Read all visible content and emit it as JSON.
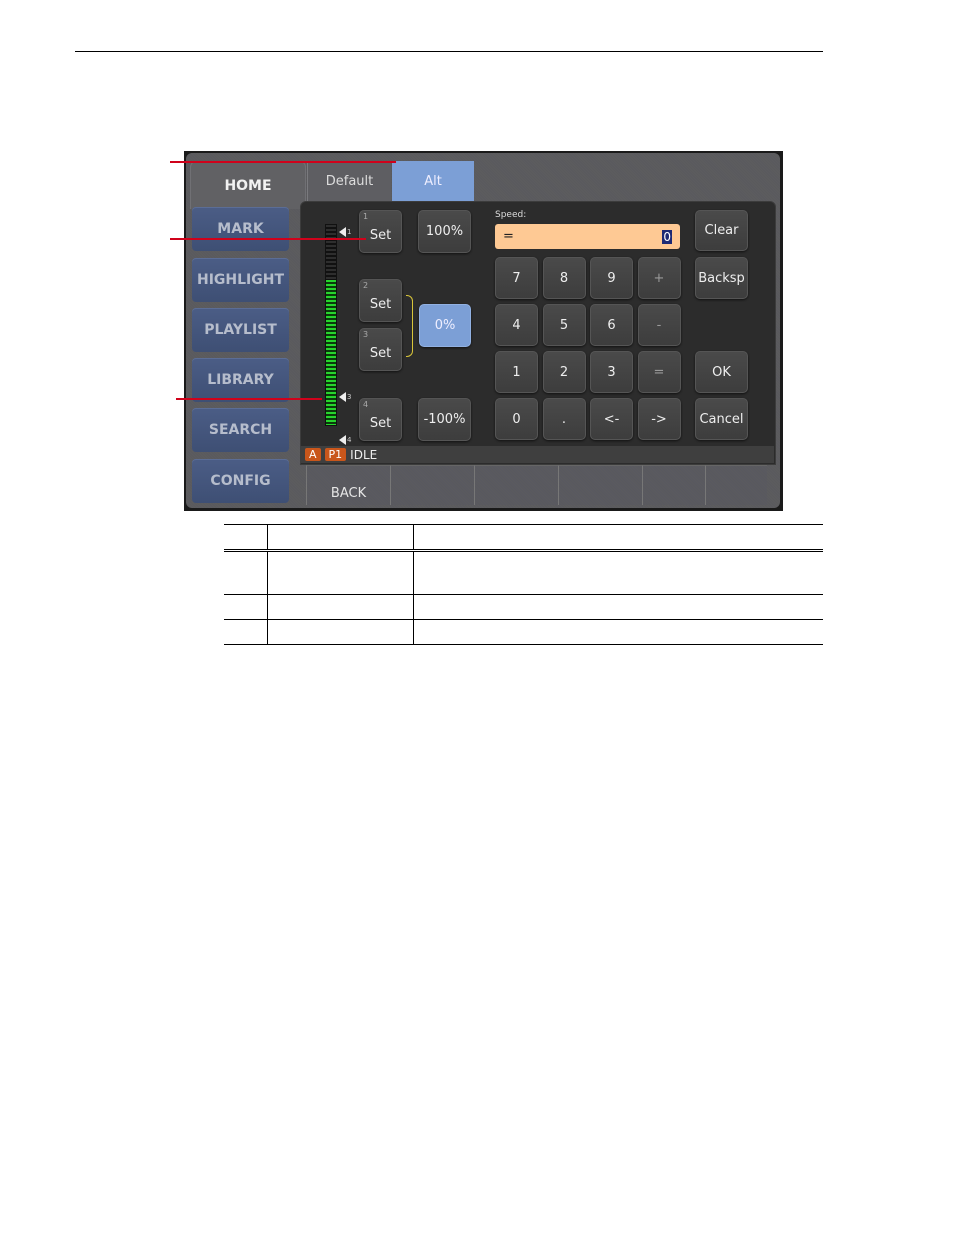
{
  "tabs": [
    {
      "label": "HOME",
      "active": true
    },
    {
      "label": "Default",
      "active": false
    },
    {
      "label": "Alt",
      "active": true
    }
  ],
  "nav": [
    "MARK",
    "HIGHLIGHT",
    "PLAYLIST",
    "LIBRARY",
    "SEARCH",
    "CONFIG"
  ],
  "meter": {
    "level_fraction": 0.73,
    "markers": [
      "1",
      "2",
      "3",
      "4"
    ]
  },
  "presets": [
    {
      "index": "1",
      "label": "Set"
    },
    {
      "index": "2",
      "label": "Set"
    },
    {
      "index": "3",
      "label": "Set"
    },
    {
      "index": "4",
      "label": "Set"
    }
  ],
  "speed_buttons": {
    "plus100": "100%",
    "zero": "0%",
    "minus100": "-100%"
  },
  "speed": {
    "label": "Speed:",
    "value": "=",
    "cursor": "0"
  },
  "keypad": [
    [
      "7",
      "8",
      "9",
      "+"
    ],
    [
      "4",
      "5",
      "6",
      "-"
    ],
    [
      "1",
      "2",
      "3",
      "="
    ],
    [
      "0",
      ".",
      "<-",
      "->"
    ]
  ],
  "actions": {
    "clear": "Clear",
    "backsp": "Backsp",
    "ok": "OK",
    "cancel": "Cancel"
  },
  "status": {
    "channel": "A",
    "player": "P1",
    "state": "IDLE"
  },
  "softkeys": [
    "BACK",
    "",
    "",
    "",
    "",
    ""
  ],
  "colors": {
    "accent_blue": "#7c9fd6",
    "speed_field": "#fec994",
    "badge": "#c9561b",
    "meter_green": "#27d42d",
    "callout_red": "#d0021b"
  },
  "table": {
    "rows": 4,
    "columns": 3
  }
}
